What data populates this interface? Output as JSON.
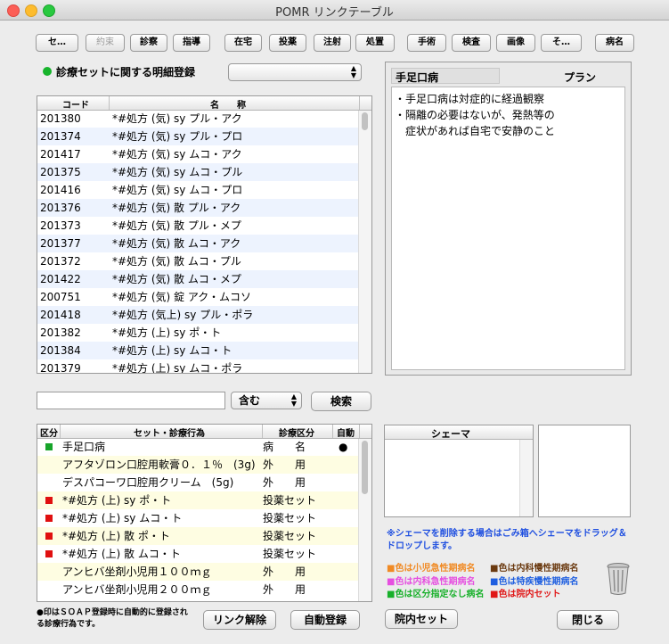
{
  "window": {
    "title": "POMR リンクテーブル"
  },
  "toolbar": {
    "buttons": [
      {
        "label": "セ…",
        "enabled": true
      },
      {
        "label": "約束",
        "enabled": false
      },
      {
        "label": "診察",
        "enabled": true
      },
      {
        "label": "指導",
        "enabled": true
      },
      {
        "label": "在宅",
        "enabled": true
      },
      {
        "label": "投薬",
        "enabled": true
      },
      {
        "label": "注射",
        "enabled": true
      },
      {
        "label": "処置",
        "enabled": true
      },
      {
        "label": "手術",
        "enabled": true
      },
      {
        "label": "検査",
        "enabled": true
      },
      {
        "label": "画像",
        "enabled": true
      },
      {
        "label": "そ…",
        "enabled": true
      },
      {
        "label": "病名",
        "enabled": true
      }
    ]
  },
  "registration": {
    "label": "診療セットに関する明細登録",
    "select_value": ""
  },
  "code_table": {
    "columns": [
      "コード",
      "名　　称"
    ],
    "rows": [
      {
        "code": "201380",
        "name": "*#処方 (気) sy プル・アク"
      },
      {
        "code": "201374",
        "name": "*#処方 (気) sy プル・プロ"
      },
      {
        "code": "201417",
        "name": "*#処方 (気) sy ムコ・アク"
      },
      {
        "code": "201375",
        "name": "*#処方 (気) sy ムコ・プル"
      },
      {
        "code": "201416",
        "name": "*#処方 (気) sy ムコ・プロ"
      },
      {
        "code": "201376",
        "name": "*#処方 (気) 散 プル・アク"
      },
      {
        "code": "201373",
        "name": "*#処方 (気) 散 プル・メプ"
      },
      {
        "code": "201377",
        "name": "*#処方 (気) 散 ムコ・アク"
      },
      {
        "code": "201372",
        "name": "*#処方 (気) 散 ムコ・プル"
      },
      {
        "code": "201422",
        "name": "*#処方 (気) 散 ムコ・メプ"
      },
      {
        "code": "200751",
        "name": "*#処方 (気) 錠 アク・ムコソ"
      },
      {
        "code": "201418",
        "name": "*#処方 (気上) sy プル・ポラ"
      },
      {
        "code": "201382",
        "name": "*#処方 (上) sy ポ・ト"
      },
      {
        "code": "201384",
        "name": "*#処方 (上) sy ムコ・ト"
      },
      {
        "code": "201379",
        "name": "*#処方 (上) sy ムコ・ポラ"
      }
    ]
  },
  "search": {
    "value": "",
    "mode": "含む",
    "button": "検索"
  },
  "plan_panel": {
    "disease": "手足口病",
    "plan_label": "プラン",
    "lines": [
      "・手足口病は対症的に経過観察",
      "・隔離の必要はないが、発熱等の",
      "　症状があれば自宅で安静のこと"
    ]
  },
  "set_table": {
    "columns": [
      "区分",
      "セット・診療行為",
      "診療区分",
      "自動"
    ],
    "rows": [
      {
        "mark": "green",
        "name": "手足口病",
        "category": "病　　名",
        "auto": "●",
        "style": "white"
      },
      {
        "mark": "",
        "name": "アフタゾロン口腔用軟膏０．１％　(3g)",
        "category": "外　　用",
        "auto": "",
        "style": "yellow"
      },
      {
        "mark": "",
        "name": "デスパコーワ口腔用クリーム　(5g)",
        "category": "外　　用",
        "auto": "",
        "style": "white"
      },
      {
        "mark": "red",
        "name": "*#処方 (上) sy ポ・ト",
        "category": "投薬セット",
        "auto": "",
        "style": "yellow"
      },
      {
        "mark": "red",
        "name": "*#処方 (上) sy ムコ・ト",
        "category": "投薬セット",
        "auto": "",
        "style": "white"
      },
      {
        "mark": "red",
        "name": "*#処方 (上) 散 ポ・ト",
        "category": "投薬セット",
        "auto": "",
        "style": "yellow"
      },
      {
        "mark": "red",
        "name": "*#処方 (上) 散 ムコ・ト",
        "category": "投薬セット",
        "auto": "",
        "style": "white"
      },
      {
        "mark": "",
        "name": "アンヒバ坐剤小児用１００ｍｇ",
        "category": "外　　用",
        "auto": "",
        "style": "yellow"
      },
      {
        "mark": "",
        "name": "アンヒバ坐剤小児用２００ｍｇ",
        "category": "外　　用",
        "auto": "",
        "style": "white"
      }
    ]
  },
  "schema": {
    "header": "シェーマ",
    "note_line1": "※シェーマを削除する場合はごみ箱へシェーマをドラッグ＆",
    "note_line2": "ドロップします。"
  },
  "legend": {
    "items": [
      {
        "text": "■色は小児急性期病名",
        "color": "#f08a24"
      },
      {
        "text": "■色は内科慢性期病名",
        "color": "#6b3a10"
      },
      {
        "text": "■色は内科急性期病名",
        "color": "#e64fe0"
      },
      {
        "text": "■色は特疾慢性期病名",
        "color": "#1f5fe0"
      },
      {
        "text": "■色は区分指定なし病名",
        "color": "#18b02a"
      },
      {
        "text": "■色は院内セット",
        "color": "#e01818"
      }
    ]
  },
  "footer": {
    "note_line1": "●印はＳＯＡＰ登録時に自動的に登録され",
    "note_line2": "る診療行為です。",
    "unlink": "リンク解除",
    "auto_register": "自動登録",
    "in_house_set": "院内セット",
    "close": "閉じる"
  },
  "colors": {
    "mark_green": "#17a42a",
    "mark_red": "#e01010",
    "alt_row": "#edf3fe",
    "yellow_row": "#fefde2"
  }
}
